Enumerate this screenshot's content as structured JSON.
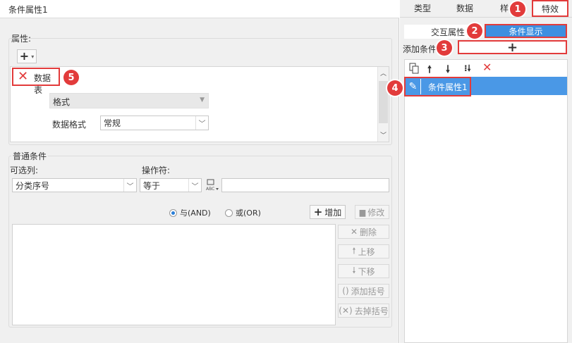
{
  "left_panel": {
    "title": "条件属性1",
    "attributes": {
      "label": "属性:",
      "add_button": "+",
      "item_label": "数据表",
      "format_label": "格式",
      "data_format_label": "数据格式",
      "data_format_value": "常规"
    },
    "conditions": {
      "label": "普通条件",
      "column_label": "可选列:",
      "column_value": "分类序号",
      "operator_label": "操作符:",
      "operator_value": "等于",
      "value_input": "",
      "and_label": "与(AND)",
      "or_label": "或(OR)",
      "add_button": "增加",
      "modify_button": "修改",
      "delete_button": "删除",
      "move_up_button": "上移",
      "move_down_button": "下移",
      "add_bracket_button": "添加括号",
      "remove_bracket_button": "去掉括号"
    }
  },
  "right_panel": {
    "tabs": [
      "类型",
      "数据",
      "样式",
      "特效"
    ],
    "interaction_label": "交互属性",
    "condition_display_button": "条件显示",
    "add_condition_label": "添加条件",
    "add_condition_button": "+",
    "list_items": [
      "条件属性1"
    ]
  },
  "badges": [
    "1",
    "2",
    "3",
    "4",
    "5"
  ],
  "colors": {
    "accent": "#3d8fe0",
    "highlight_red": "#e23b3b",
    "selected_row": "#4a98e6"
  }
}
